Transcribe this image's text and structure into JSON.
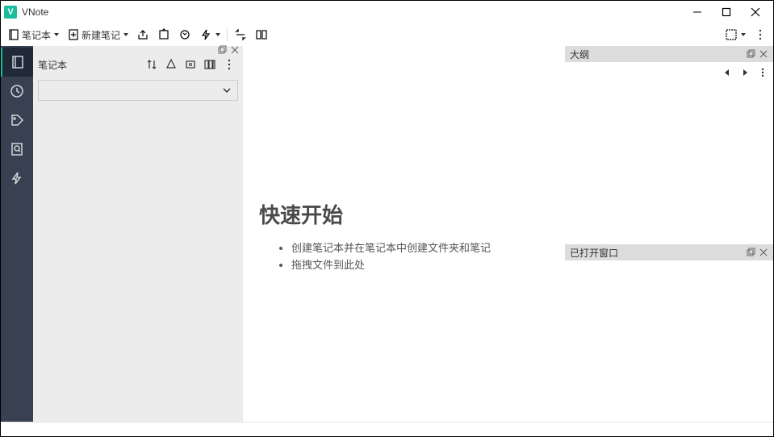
{
  "app": {
    "title": "VNote"
  },
  "toolbar": {
    "notebook": "笔记本",
    "new_note": "新建笔记"
  },
  "left_panel": {
    "header": "笔记本"
  },
  "center": {
    "heading": "快速开始",
    "tips": [
      "创建笔记本并在笔记本中创建文件夹和笔记",
      "拖拽文件到此处"
    ]
  },
  "right_panel": {
    "outline_title": "大纲",
    "opened_title": "已打开窗口"
  }
}
